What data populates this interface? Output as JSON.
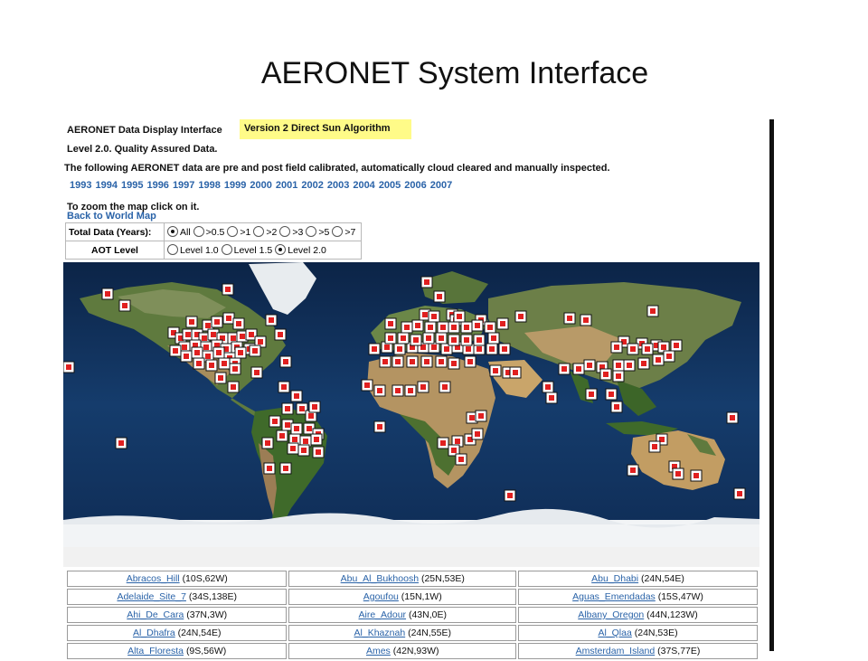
{
  "slide": {
    "title": "AERONET System Interface"
  },
  "header": {
    "interface_label": "AERONET Data Display Interface",
    "version_label": "Version 2 Direct Sun Algorithm",
    "level_label": "Level 2.0. Quality Assured Data.",
    "description": "The following AERONET data are pre and post field calibrated, automatically cloud cleared and manually inspected.",
    "zoom_hint": "To zoom the map click on it.",
    "back_link": "Back to World Map"
  },
  "years": [
    "1993",
    "1994",
    "1995",
    "1996",
    "1997",
    "1998",
    "1999",
    "2000",
    "2001",
    "2002",
    "2003",
    "2004",
    "2005",
    "2006",
    "2007"
  ],
  "filters": {
    "total_data_label": "Total Data (Years):",
    "total_data_options": [
      "All",
      ">0.5",
      ">1",
      ">2",
      ">3",
      ">5",
      ">7"
    ],
    "total_data_selected": "All",
    "aot_label": "AOT Level",
    "aot_options": [
      "Level 1.0",
      "Level 1.5",
      "Level 2.0"
    ],
    "aot_selected": "Level 2.0"
  },
  "colors": {
    "link": "#2a63a8",
    "highlight": "#fffb88",
    "marker": "#e02020"
  },
  "sites_table": [
    [
      {
        "name": "Abracos_Hill",
        "coord": "(10S,62W)"
      },
      {
        "name": "Abu_Al_Bukhoosh",
        "coord": "(25N,53E)"
      },
      {
        "name": "Abu_Dhabi",
        "coord": "(24N,54E)"
      }
    ],
    [
      {
        "name": "Adelaide_Site_7",
        "coord": "(34S,138E)"
      },
      {
        "name": "Agoufou",
        "coord": "(15N,1W)"
      },
      {
        "name": "Aguas_Emendadas",
        "coord": "(15S,47W)"
      }
    ],
    [
      {
        "name": "Ahi_De_Cara",
        "coord": "(37N,3W)"
      },
      {
        "name": "Aire_Adour",
        "coord": "(43N,0E)"
      },
      {
        "name": "Albany_Oregon",
        "coord": "(44N,123W)"
      }
    ],
    [
      {
        "name": "Al_Dhafra",
        "coord": "(24N,54E)"
      },
      {
        "name": "Al_Khaznah",
        "coord": "(24N,55E)"
      },
      {
        "name": "Al_Qlaa",
        "coord": "(24N,53E)"
      }
    ],
    [
      {
        "name": "Alta_Floresta",
        "coord": "(9S,56W)"
      },
      {
        "name": "Ames",
        "coord": "(42N,93W)"
      },
      {
        "name": "Amsterdam_Island",
        "coord": "(37S,77E)"
      }
    ]
  ]
}
